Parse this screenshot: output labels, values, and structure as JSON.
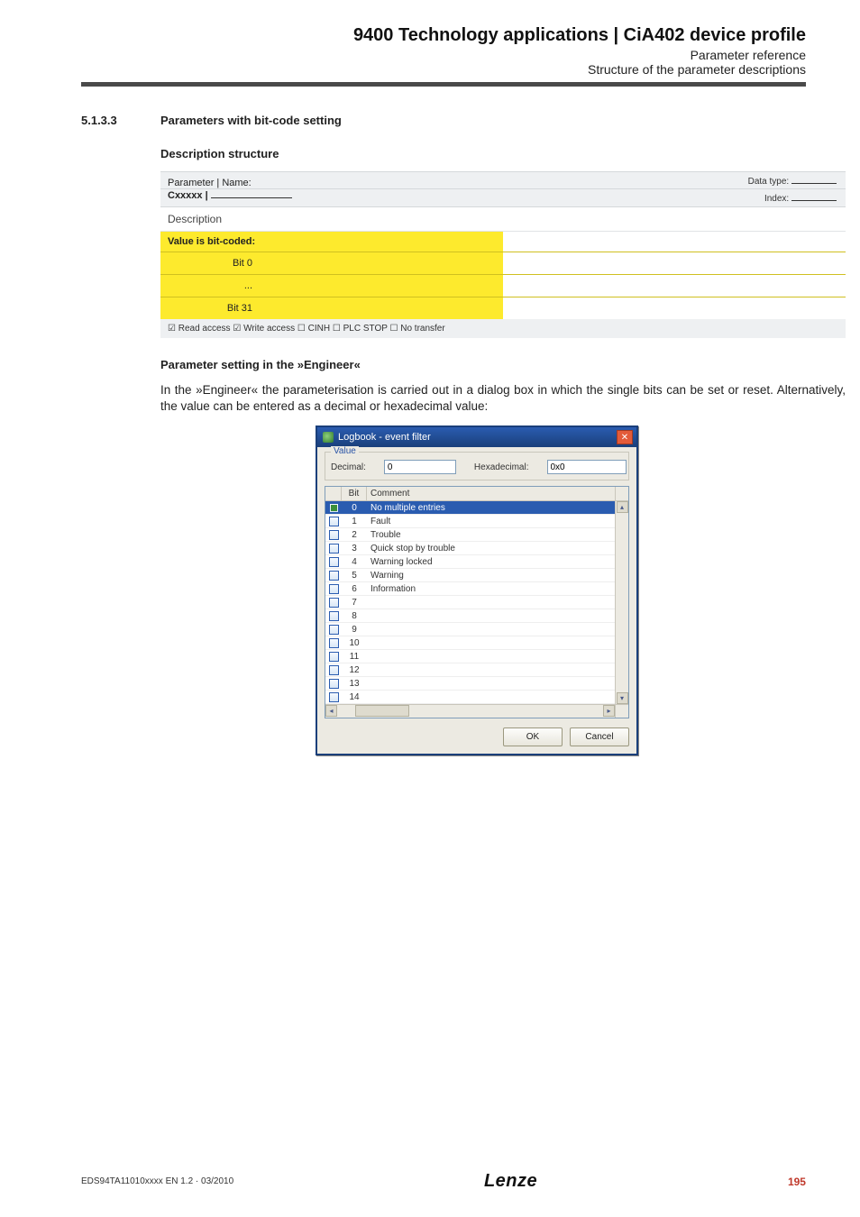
{
  "header": {
    "title": "9400 Technology applications | CiA402 device profile",
    "sub1": "Parameter reference",
    "sub2": "Structure of the parameter descriptions"
  },
  "section": {
    "num": "5.1.3.3",
    "title": "Parameters with bit-code setting"
  },
  "sub1": "Description structure",
  "table": {
    "paramName": "Parameter | Name:",
    "cxxxxx": "Cxxxxx |",
    "dataType": "Data type:",
    "index": "Index:",
    "description": "Description",
    "valueBitCoded": "Value is bit-coded:",
    "bit0": "Bit 0",
    "dots": "...",
    "bit31": "Bit 31",
    "footer": "☑ Read access   ☑ Write access   ☐ CINH   ☐ PLC STOP   ☐ No transfer"
  },
  "sub2": "Parameter setting in the »Engineer«",
  "para": "In the »Engineer« the parameterisation is carried out in a dialog box in which the single bits can be set or reset. Alternatively, the value can be entered as a decimal or hexadecimal value:",
  "dialog": {
    "title": "Logbook - event filter",
    "groupLegend": "Value",
    "decimalLabel": "Decimal:",
    "decimalValue": "0",
    "hexLabel": "Hexadecimal:",
    "hexValue": "0x0",
    "headers": {
      "bit": "Bit",
      "comment": "Comment"
    },
    "rows": [
      {
        "bit": "0",
        "comment": "No multiple entries",
        "checked": true,
        "selected": true
      },
      {
        "bit": "1",
        "comment": "Fault",
        "checked": false,
        "selected": false
      },
      {
        "bit": "2",
        "comment": "Trouble",
        "checked": false,
        "selected": false
      },
      {
        "bit": "3",
        "comment": "Quick stop by trouble",
        "checked": false,
        "selected": false
      },
      {
        "bit": "4",
        "comment": "Warning locked",
        "checked": false,
        "selected": false
      },
      {
        "bit": "5",
        "comment": "Warning",
        "checked": false,
        "selected": false
      },
      {
        "bit": "6",
        "comment": "Information",
        "checked": false,
        "selected": false
      },
      {
        "bit": "7",
        "comment": "",
        "checked": false,
        "selected": false
      },
      {
        "bit": "8",
        "comment": "",
        "checked": false,
        "selected": false
      },
      {
        "bit": "9",
        "comment": "",
        "checked": false,
        "selected": false
      },
      {
        "bit": "10",
        "comment": "",
        "checked": false,
        "selected": false
      },
      {
        "bit": "11",
        "comment": "",
        "checked": false,
        "selected": false
      },
      {
        "bit": "12",
        "comment": "",
        "checked": false,
        "selected": false
      },
      {
        "bit": "13",
        "comment": "",
        "checked": false,
        "selected": false
      },
      {
        "bit": "14",
        "comment": "",
        "checked": false,
        "selected": false
      }
    ],
    "ok": "OK",
    "cancel": "Cancel"
  },
  "footer": {
    "docid": "EDS94TA11010xxxx EN 1.2 · 03/2010",
    "brand": "Lenze",
    "page": "195"
  }
}
